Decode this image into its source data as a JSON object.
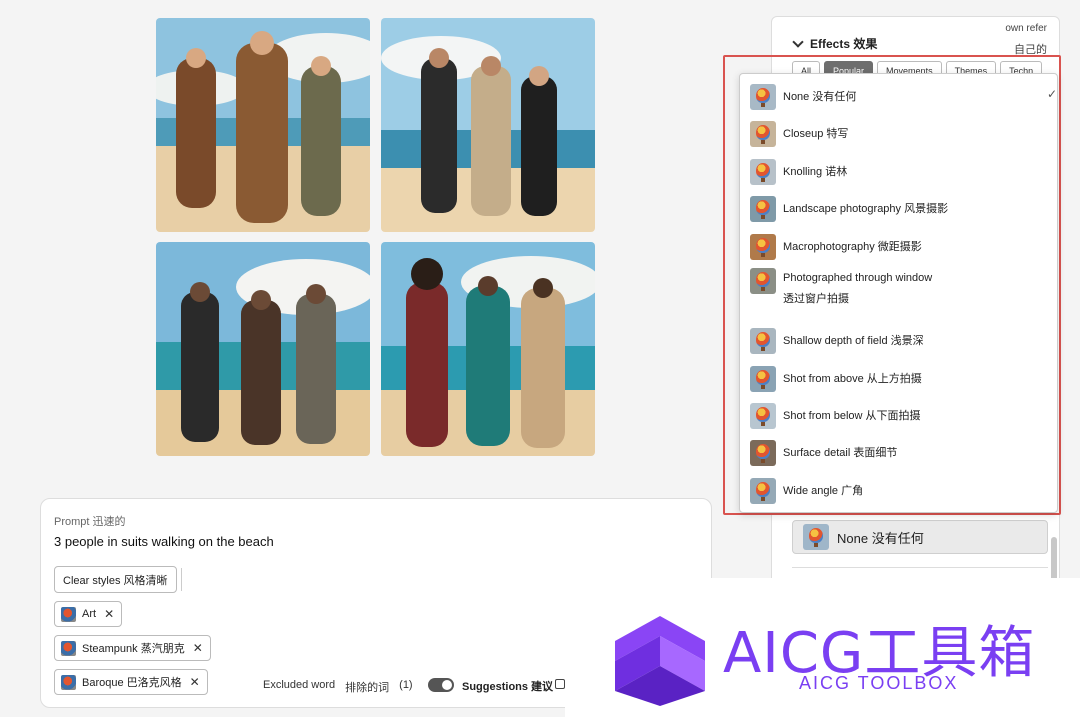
{
  "panel": {
    "own_ref": "own refer",
    "own_ref_cn": "自己的",
    "effects_title": "Effects 效果",
    "tabs": [
      {
        "label": "All",
        "active": false
      },
      {
        "label": "Popular",
        "active": true
      },
      {
        "label": "Movements",
        "active": false
      },
      {
        "label": "Themes",
        "active": false
      },
      {
        "label": "Techn",
        "active": false
      }
    ],
    "selected_effect": "None 没有任何"
  },
  "dropdown": {
    "check_icon": "checkmark-icon",
    "options": [
      {
        "label": "None 没有任何"
      },
      {
        "label": "Closeup 特写"
      },
      {
        "label": "Knolling 诺林"
      },
      {
        "label": "Landscape photography 风景摄影"
      },
      {
        "label": "Macrophotography 微距摄影"
      },
      {
        "label": "Photographed through window",
        "label2": "透过窗户拍摄"
      },
      {
        "label": "Shallow depth of field 浅景深"
      },
      {
        "label": "Shot from above 从上方拍摄"
      },
      {
        "label": "Shot from below 从下面拍摄"
      },
      {
        "label": "Surface detail 表面细节"
      },
      {
        "label": "Wide angle 广角"
      }
    ]
  },
  "prompt": {
    "label": "Prompt 迅速的",
    "text": "3 people in suits walking on the beach",
    "clear_label": "Clear styles 风格清晰",
    "chips": [
      {
        "label": "Art"
      },
      {
        "label": "Steampunk 蒸汽朋克"
      },
      {
        "label": "Baroque 巴洛克风格"
      }
    ],
    "excluded_label": "Excluded word",
    "excluded_cn": "排除的词",
    "excluded_count": "(1)",
    "suggestions_label": "Suggestions 建议"
  },
  "watermark": {
    "title": "AICG工具箱",
    "subtitle": "AICG TOOLBOX",
    "accent": "#7a3ff2"
  }
}
